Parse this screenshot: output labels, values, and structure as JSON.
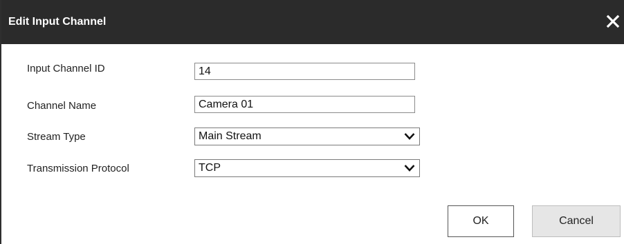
{
  "dialog": {
    "title": "Edit Input Channel",
    "close_icon": "close-icon"
  },
  "fields": {
    "input_channel_id": {
      "label": "Input Channel ID",
      "value": "14"
    },
    "channel_name": {
      "label": "Channel Name",
      "value": "Camera 01"
    },
    "stream_type": {
      "label": "Stream Type",
      "value": "Main Stream"
    },
    "transmission_protocol": {
      "label": "Transmission Protocol",
      "value": "TCP"
    }
  },
  "buttons": {
    "ok": "OK",
    "cancel": "Cancel"
  },
  "colors": {
    "titlebar": "#2b2b2b",
    "title_text": "#ffffff",
    "cancel_bg": "#e6e6e6"
  }
}
